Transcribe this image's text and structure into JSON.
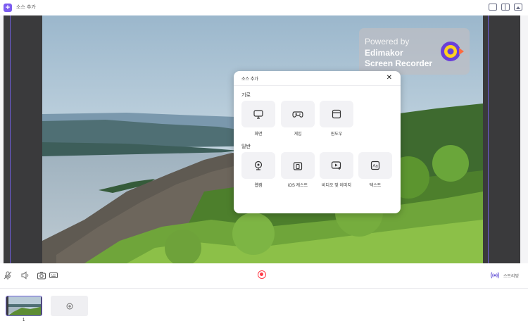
{
  "topbar": {
    "title": "소스 추가",
    "add_icon": "plus-icon",
    "icons": [
      "layout-single-icon",
      "layout-split-icon",
      "image-icon"
    ]
  },
  "watermark": {
    "powered": "Powered by",
    "brand_line1": "Edimakor",
    "brand_line2": "Screen Recorder"
  },
  "dialog": {
    "title": "소스 추가",
    "close": "✕",
    "sections": [
      {
        "label": "기로",
        "items": [
          {
            "label": "화면",
            "icon": "monitor-icon"
          },
          {
            "label": "게임",
            "icon": "gamepad-icon"
          },
          {
            "label": "윈도우",
            "icon": "window-icon"
          }
        ]
      },
      {
        "label": "일반",
        "items": [
          {
            "label": "웹캠",
            "icon": "webcam-icon"
          },
          {
            "label": "iOS 캐스트",
            "icon": "phone-cast-icon"
          },
          {
            "label": "비디오 및 이미지",
            "icon": "media-icon"
          },
          {
            "label": "텍스트",
            "icon": "text-icon"
          }
        ]
      }
    ]
  },
  "controls": {
    "stream_label": "스트리밍",
    "icons": [
      "mic-icon",
      "speaker-icon",
      "camera-icon",
      "keyboard-icon",
      "record-icon",
      "broadcast-icon"
    ]
  },
  "scenes": {
    "items": [
      {
        "number": "1"
      }
    ],
    "add_icon": "add-scene-icon"
  },
  "colors": {
    "accent": "#7c5cf0",
    "record": "#ff3b47",
    "guide": "#6e5dd8"
  }
}
